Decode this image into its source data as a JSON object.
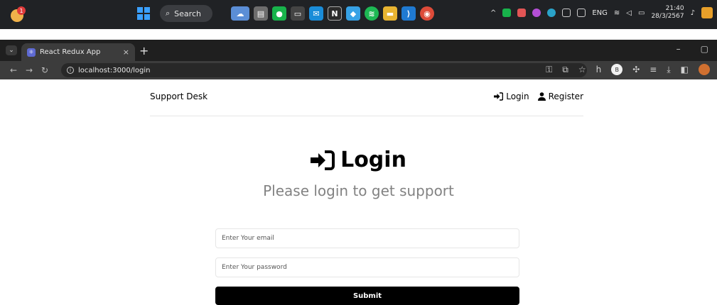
{
  "taskbar": {
    "search_label": "Search",
    "tray_language": "ENG",
    "clock_time": "21:40",
    "clock_date": "28/3/2567",
    "notification_badge": "1"
  },
  "browser": {
    "tab_title": "React Redux App",
    "tab_close": "×",
    "new_tab": "+",
    "url": "localhost:3000/login",
    "profile_letter": "B"
  },
  "header": {
    "brand": "Support Desk",
    "login_label": "Login",
    "register_label": "Register"
  },
  "main": {
    "heading": "Login",
    "subheading": "Please login to get support"
  },
  "form": {
    "email_placeholder": "Enter Your email",
    "password_placeholder": "Enter Your password",
    "submit_label": "Submit"
  },
  "colors": {
    "accent": "#000000",
    "subheading": "#828282",
    "taskbar_bg": "#202225"
  }
}
